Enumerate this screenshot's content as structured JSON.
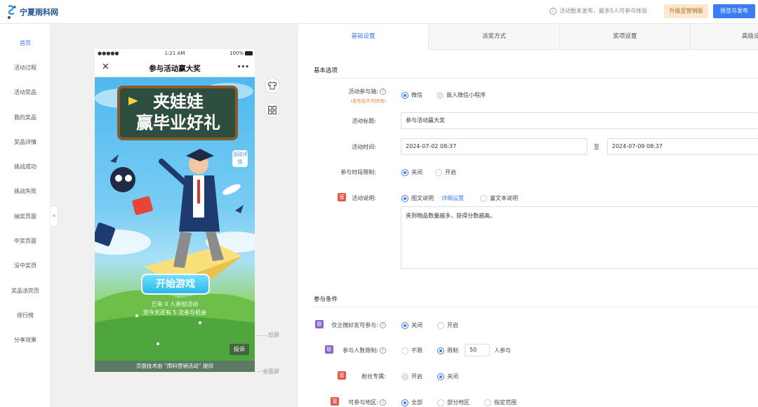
{
  "header": {
    "logo_text": "宁夏雨科网",
    "notice": "活动暂未发布，最多5人可参与体验",
    "upgrade_label": "升级至营销版",
    "publish_label": "预览与发布"
  },
  "sidebar": {
    "items": [
      {
        "label": "首页"
      },
      {
        "label": "活动过程"
      },
      {
        "label": "活动奖品"
      },
      {
        "label": "我的奖品"
      },
      {
        "label": "奖品详情"
      },
      {
        "label": "挑战成功"
      },
      {
        "label": "挑战失败"
      },
      {
        "label": "抽奖页面"
      },
      {
        "label": "中奖页面"
      },
      {
        "label": "没中奖页"
      },
      {
        "label": "奖品派完页"
      },
      {
        "label": "排行榜"
      },
      {
        "label": "分享效果"
      }
    ],
    "collapse_icon": "«"
  },
  "phone": {
    "carrier": "●●●●●",
    "time": "1:21 AM",
    "battery": "100%",
    "title": "参与活动赢大奖",
    "close_icon": "✕",
    "more_icon": "•••",
    "banner_line1": "夹娃娃",
    "banner_line2": "赢毕业好礼",
    "side_tag": "活动详情",
    "start_button": "开始游戏",
    "participants_text": "已有 0 人参加活动",
    "chances_text": "您今天还有 5 次参与机会",
    "report_button": "投诉",
    "footer": "页面技术由 “雨科营销活动” 提供"
  },
  "preview_hints": {
    "short_screen": "短屏",
    "full_screen": "全面屏"
  },
  "tabs": [
    {
      "label": "基础设置",
      "active": true
    },
    {
      "label": "派奖方式",
      "active": false
    },
    {
      "label": "奖项设置",
      "active": false
    },
    {
      "label": "高级设",
      "active": false
    }
  ],
  "form": {
    "basic_section": "基本选项",
    "entry_label": "活动参与端:",
    "entry_note": "(发布后不可修改)",
    "entry_options": [
      "微信",
      "嵌入微信小程序"
    ],
    "title_label": "活动标题:",
    "title_value": "参与活动赢大奖",
    "time_label": "活动时间:",
    "start_time": "2024-07-02 08:37",
    "time_sep": "至",
    "end_time": "2024-07-09 08:37",
    "slot_label": "参与时段限制:",
    "slot_options": [
      "关闭",
      "开启"
    ],
    "desc_label": "活动说明:",
    "desc_options": [
      "图文说明",
      "详细设置",
      "富文本说明"
    ],
    "desc_value": "夹到物品数量越多，获得分数越高。",
    "cond_section": "参与条件",
    "friends_label": "仅企微好友可参与:",
    "friends_options": [
      "关闭",
      "开启"
    ],
    "count_label": "参与人数限制:",
    "count_options": [
      "不限",
      "限制"
    ],
    "count_value": "50",
    "count_unit": "人参与",
    "fans_label": "粉丝专属:",
    "fans_options": [
      "开启",
      "关闭"
    ],
    "region_label": "可参与地区:",
    "region_options": [
      "全部",
      "部分地区",
      "指定范围"
    ],
    "badge_ying": "营",
    "badge_lian": "联"
  },
  "colors": {
    "accent": "#3b7bf5",
    "upgrade_bg": "#fde7cf",
    "badge_red": "#e8584a",
    "badge_purple": "#8a63d2"
  }
}
